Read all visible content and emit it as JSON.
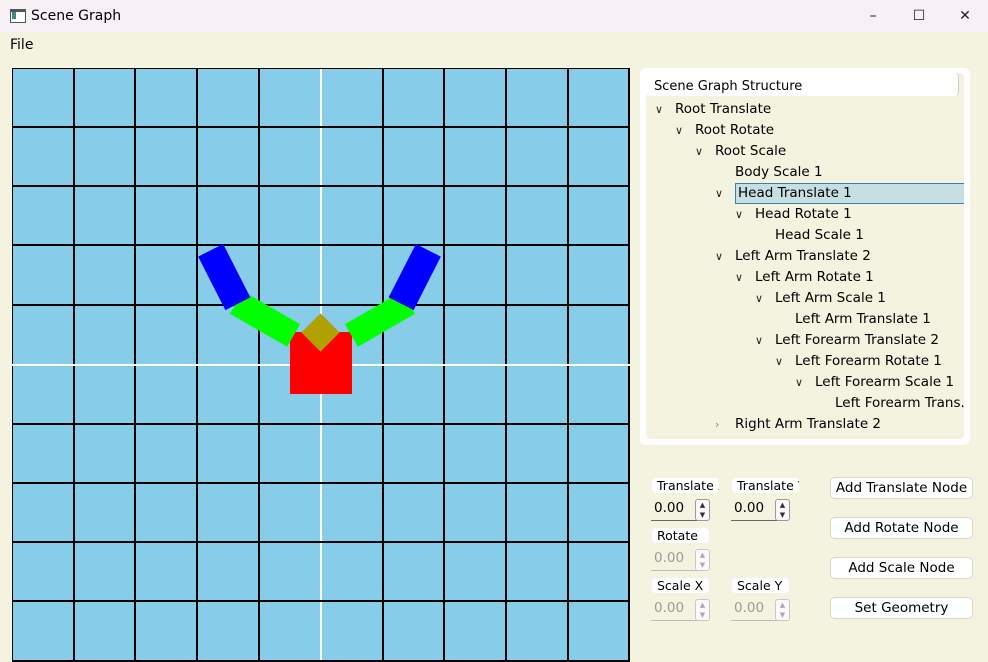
{
  "window": {
    "title": "Scene Graph",
    "minimize_glyph": "–",
    "maximize_glyph": "☐",
    "close_glyph": "✕"
  },
  "menu": {
    "file": "File"
  },
  "tree": {
    "header": "Scene Graph Structure",
    "rows": [
      {
        "label": "Root Translate",
        "depth": 0,
        "state": "expanded"
      },
      {
        "label": "Root Rotate",
        "depth": 1,
        "state": "expanded"
      },
      {
        "label": "Root Scale",
        "depth": 2,
        "state": "expanded"
      },
      {
        "label": "Body Scale 1",
        "depth": 3,
        "state": "leaf"
      },
      {
        "label": "Head Translate 1",
        "depth": 3,
        "state": "expanded",
        "selected": true
      },
      {
        "label": "Head Rotate 1",
        "depth": 4,
        "state": "expanded"
      },
      {
        "label": "Head Scale 1",
        "depth": 5,
        "state": "leaf"
      },
      {
        "label": "Left Arm Translate 2",
        "depth": 3,
        "state": "expanded"
      },
      {
        "label": "Left Arm Rotate 1",
        "depth": 4,
        "state": "expanded"
      },
      {
        "label": "Left Arm Scale 1",
        "depth": 5,
        "state": "expanded"
      },
      {
        "label": "Left Arm Translate 1",
        "depth": 6,
        "state": "leaf"
      },
      {
        "label": "Left Forearm Translate 2",
        "depth": 5,
        "state": "expanded"
      },
      {
        "label": "Left Forearm Rotate 1",
        "depth": 6,
        "state": "expanded"
      },
      {
        "label": "Left Forearm Scale 1",
        "depth": 7,
        "state": "expanded"
      },
      {
        "label": "Left Forearm Trans...",
        "depth": 8,
        "state": "leaf"
      },
      {
        "label": "Right Arm Translate 2",
        "depth": 3,
        "state": "collapsed"
      }
    ]
  },
  "controls": {
    "translate_x": {
      "label": "Translate X",
      "value": "0.00",
      "enabled": true
    },
    "translate_y": {
      "label": "Translate Y",
      "value": "0.00",
      "enabled": true
    },
    "rotate": {
      "label": "Rotate",
      "value": "0.00",
      "enabled": false
    },
    "scale_x": {
      "label": "Scale X",
      "value": "0.00",
      "enabled": false
    },
    "scale_y": {
      "label": "Scale Y",
      "value": "0.00",
      "enabled": false
    },
    "spin_up_glyph": "▲",
    "spin_down_glyph": "▼"
  },
  "buttons": {
    "add_translate": "Add Translate Node",
    "add_rotate": "Add Rotate Node",
    "add_scale": "Add Scale Node",
    "set_geometry": "Set Geometry"
  },
  "scene": {
    "background_color": "#87cce8",
    "grid_color": "#000000",
    "axis_color": "#ffffff",
    "shapes": [
      {
        "name": "body",
        "color": "#ff0000"
      },
      {
        "name": "head",
        "color": "#b0a000"
      },
      {
        "name": "left-arm",
        "color": "#00ff00"
      },
      {
        "name": "left-forearm",
        "color": "#0000ff"
      },
      {
        "name": "right-arm",
        "color": "#00ff00"
      },
      {
        "name": "right-forearm",
        "color": "#0000ff"
      }
    ]
  }
}
